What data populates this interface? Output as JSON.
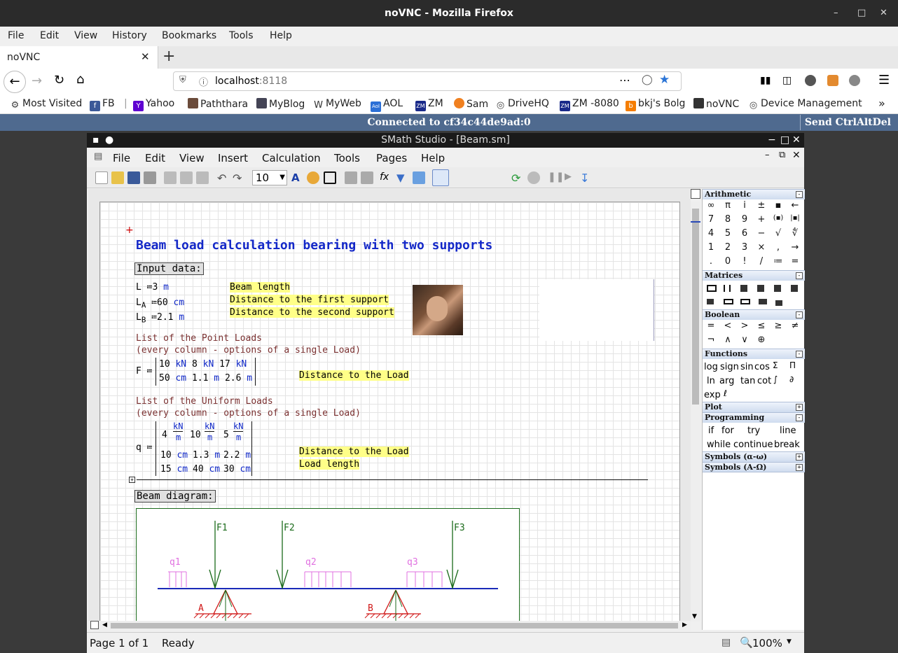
{
  "browser": {
    "window_title": "noVNC - Mozilla Firefox",
    "menu": [
      "File",
      "Edit",
      "View",
      "History",
      "Bookmarks",
      "Tools",
      "Help"
    ],
    "tab_label": "noVNC",
    "url_host": "localhost",
    "url_port": ":8118",
    "bookmarks": [
      "Most Visited",
      "FB",
      "Yahoo",
      "Paththara",
      "MyBlog",
      "MyWeb",
      "AOL",
      "ZM",
      "Sam",
      "DriveHQ",
      "ZM -8080",
      "bkj's Bolg",
      "noVNC",
      "Device Management"
    ]
  },
  "novnc": {
    "status": "Connected to cf34c44de9ad:0",
    "send_cad": "Send CtrlAltDel"
  },
  "smath": {
    "title": "SMath Studio - [Beam.sm]",
    "menu": [
      "File",
      "Edit",
      "View",
      "Insert",
      "Calculation",
      "Tools",
      "Pages",
      "Help"
    ],
    "font_size": "10",
    "status_page": "Page 1 of 1",
    "status_state": "Ready",
    "zoom": "100%"
  },
  "doc": {
    "heading": "Beam load calculation bearing with two supports",
    "input_label": "Input data:",
    "defs": [
      {
        "var": "L",
        "sub": "",
        "val": "3",
        "unit": "m",
        "comment": "Beam length"
      },
      {
        "var": "L",
        "sub": "A",
        "val": "60",
        "unit": "cm",
        "comment": "Distance to the first support"
      },
      {
        "var": "L",
        "sub": "B",
        "val": "2.1",
        "unit": "m",
        "comment": "Distance to the second support"
      }
    ],
    "assign": "≔",
    "point_title1": "List of the Point Loads",
    "point_title2": "(every column - options of  a single Load)",
    "F_var": "F",
    "F_row1": [
      [
        "10",
        "kN"
      ],
      [
        "8",
        "kN"
      ],
      [
        "17",
        "kN"
      ]
    ],
    "F_row2": [
      [
        "50",
        "cm"
      ],
      [
        "1.1",
        "m"
      ],
      [
        "2.6",
        "m"
      ]
    ],
    "F_comment": "Distance to the Load",
    "uniform_title1": "List of the Uniform Loads",
    "uniform_title2": "(every column - options of  a single Load)",
    "q_var": "q",
    "q_row1": [
      [
        "4",
        "kN",
        "m"
      ],
      [
        "10",
        "kN",
        "m"
      ],
      [
        "5",
        "kN",
        "m"
      ]
    ],
    "q_row2": [
      [
        "10",
        "cm"
      ],
      [
        "1.3",
        "m"
      ],
      [
        "2.2",
        "m"
      ]
    ],
    "q_row3": [
      [
        "15",
        "cm"
      ],
      [
        "40",
        "cm"
      ],
      [
        "30",
        "cm"
      ]
    ],
    "q_comment1": "Distance to the Load",
    "q_comment2": "Load length",
    "diagram_label": "Beam diagram:",
    "diagram": {
      "forces": [
        "F1",
        "F2",
        "F3"
      ],
      "loads": [
        "q1",
        "q2",
        "q3"
      ],
      "supports": [
        "A",
        "B"
      ]
    }
  },
  "panel": {
    "arithmetic": "Arithmetic",
    "arith_rows": [
      [
        "∞",
        "π",
        "i",
        "±",
        "▪",
        "←"
      ],
      [
        "7",
        "8",
        "9",
        "+",
        "(▪)",
        "|▪|"
      ],
      [
        "4",
        "5",
        "6",
        "−",
        "√",
        "∜"
      ],
      [
        "1",
        "2",
        "3",
        "×",
        ",",
        "→"
      ],
      [
        ".",
        "0",
        "!",
        "/",
        "≔",
        "="
      ]
    ],
    "matrices": "Matrices",
    "boolean": "Boolean",
    "bool_rows": [
      [
        "=",
        "<",
        ">",
        "≤",
        "≥",
        "≠"
      ],
      [
        "¬",
        "∧",
        "∨",
        "⊕"
      ]
    ],
    "functions": "Functions",
    "func_rows": [
      [
        "log",
        "sign",
        "sin",
        "cos"
      ],
      [
        "ln",
        "arg",
        "tan",
        "cot"
      ],
      [
        "exp"
      ]
    ],
    "plot": "Plot",
    "programming": "Programming",
    "prog_rows": [
      [
        "if",
        "for",
        "try",
        "line"
      ],
      [
        "while",
        "continue",
        "break"
      ]
    ],
    "sym1": "Symbols (α-ω)",
    "sym2": "Symbols (Α-Ω)"
  }
}
